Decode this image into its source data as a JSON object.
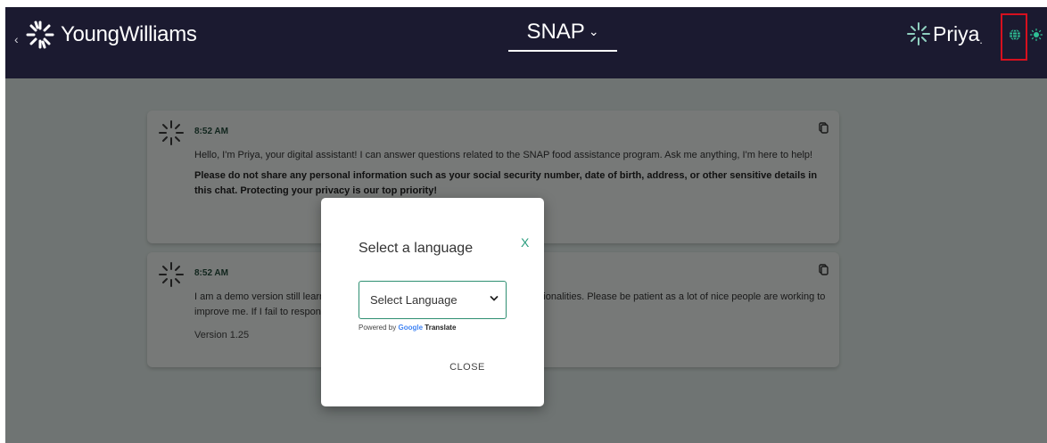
{
  "header": {
    "back_glyph": "‹",
    "brand_name": "YoungWilliams",
    "program_label": "SNAP",
    "program_chevron": "⌄",
    "assistant_name": "Priya",
    "assistant_dot": "."
  },
  "messages": [
    {
      "time": "8:52 AM",
      "text": "Hello, I'm Priya, your digital assistant! I can answer questions related to the SNAP food assistance program. Ask me anything, I'm here to help!",
      "bold": "Please do not share any personal information such as your social security number, date of birth, address, or other sensitive details in this chat. Protecting your privacy is our top priority!"
    },
    {
      "time": "8:52 AM",
      "text": "I am a demo version still learning! I may have some issues with answers or functionalities. Please be patient as a lot of nice people are working to improve me. If I fail to respond, please provide feedback.",
      "version": "Version 1.25"
    }
  ],
  "modal": {
    "title": "Select a language",
    "close_x": "X",
    "select_value": "Select Language",
    "powered_prefix": "Powered by",
    "powered_google": "Google",
    "powered_translate": "Translate",
    "close_button": "CLOSE"
  },
  "colors": {
    "header_bg": "#1b1a30",
    "page_bg": "#dfe9e6",
    "accent_green": "#2a9d7e",
    "highlight_red": "#d6101e"
  },
  "icons": {
    "brand_logo": "starburst-logo-icon",
    "avatar": "starburst-avatar-icon",
    "copy": "copy-icon",
    "globe": "globe-icon",
    "theme": "sun-icon",
    "select_arrow": "chevron-down-icon"
  }
}
